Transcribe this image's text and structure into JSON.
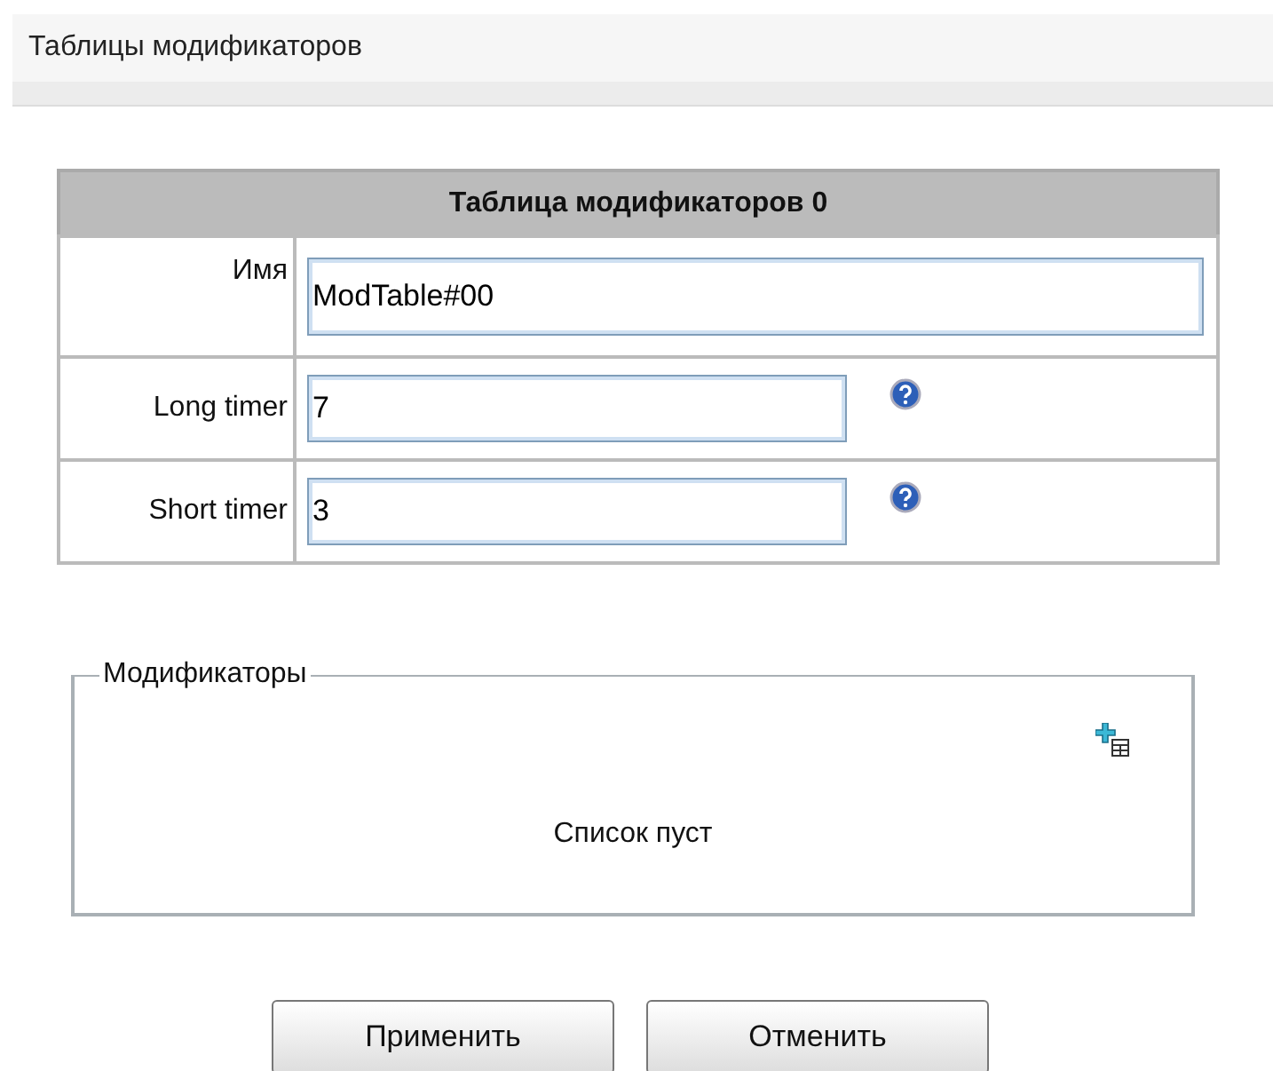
{
  "page_title": "Таблицы модификаторов",
  "table": {
    "title": "Таблица модификаторов 0",
    "rows": [
      {
        "kind": "name",
        "label": "Имя",
        "value": "ModTable#00",
        "help": false
      },
      {
        "kind": "timer",
        "label": "Long timer",
        "value": "7",
        "help": true
      },
      {
        "kind": "timer",
        "label": "Short timer",
        "value": "3",
        "help": true
      }
    ]
  },
  "modifiers": {
    "legend": "Модификаторы",
    "empty_text": "Список пуст"
  },
  "buttons": [
    "Применить",
    "Отменить"
  ]
}
